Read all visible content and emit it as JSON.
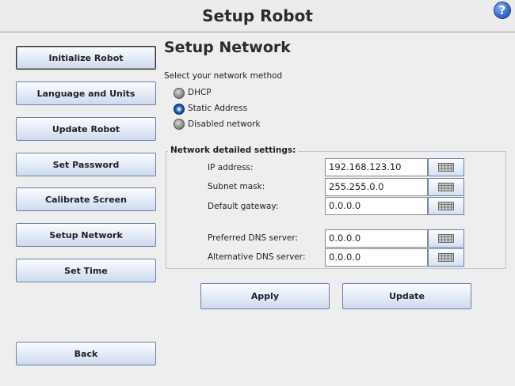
{
  "header": {
    "title": "Setup Robot",
    "help_label": "?"
  },
  "nav": {
    "initialize": "Initialize Robot",
    "language": "Language and Units",
    "update": "Update Robot",
    "password": "Set Password",
    "calibrate": "Calibrate Screen",
    "network": "Setup Network",
    "time": "Set Time",
    "back": "Back"
  },
  "main": {
    "title": "Setup Network",
    "method_prompt": "Select your network method",
    "methods": [
      {
        "label": "DHCP",
        "selected": false
      },
      {
        "label": "Static Address",
        "selected": true
      },
      {
        "label": "Disabled network",
        "selected": false
      }
    ],
    "settings_title": "Network detailed settings:",
    "fields": {
      "ip": {
        "label": "IP address:",
        "value": "192.168.123.10"
      },
      "mask": {
        "label": "Subnet mask:",
        "value": "255.255.0.0"
      },
      "gateway": {
        "label": "Default gateway:",
        "value": "0.0.0.0"
      },
      "dns1": {
        "label": "Preferred DNS server:",
        "value": "0.0.0.0"
      },
      "dns2": {
        "label": "Alternative DNS server:",
        "value": "0.0.0.0"
      }
    },
    "apply_label": "Apply",
    "update_label": "Update"
  },
  "icons": {
    "keyboard": "keyboard-icon",
    "help": "help-icon"
  }
}
